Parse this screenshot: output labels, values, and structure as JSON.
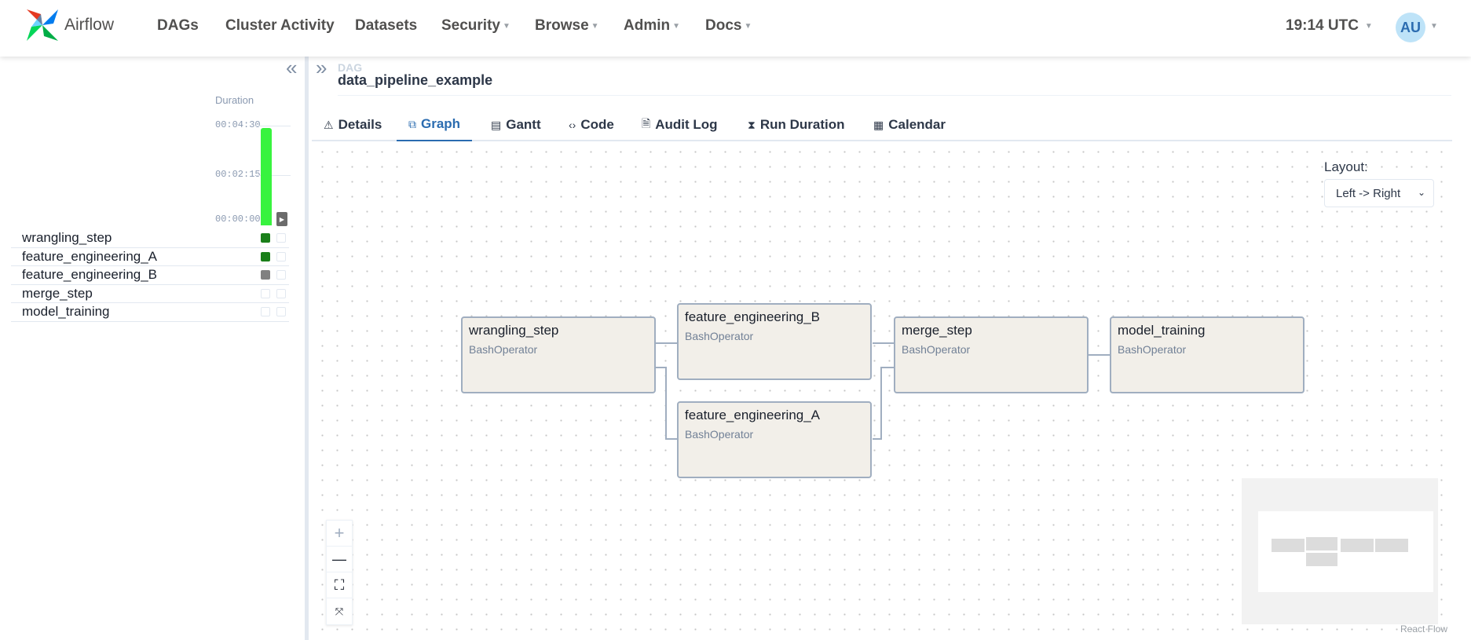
{
  "nav": {
    "brand": "Airflow",
    "items": [
      {
        "label": "DAGs",
        "caret": false
      },
      {
        "label": "Cluster Activity",
        "caret": false
      },
      {
        "label": "Datasets",
        "caret": false
      },
      {
        "label": "Security",
        "caret": true
      },
      {
        "label": "Browse",
        "caret": true
      },
      {
        "label": "Admin",
        "caret": true
      },
      {
        "label": "Docs",
        "caret": true
      }
    ],
    "clock": "19:14 UTC",
    "user_initials": "AU"
  },
  "left_panel": {
    "duration_label": "Duration",
    "ticks": [
      "00:04:30",
      "00:02:15",
      "00:00:00"
    ],
    "tasks": [
      {
        "name": "wrangling_step",
        "state": "success"
      },
      {
        "name": "feature_engineering_A",
        "state": "success"
      },
      {
        "name": "feature_engineering_B",
        "state": "grey"
      },
      {
        "name": "merge_step",
        "state": "none"
      },
      {
        "name": "model_training",
        "state": "none"
      }
    ]
  },
  "dag": {
    "label": "DAG",
    "title": "data_pipeline_example"
  },
  "tabs": [
    {
      "label": "Details",
      "icon": "warning-icon"
    },
    {
      "label": "Graph",
      "icon": "graph-icon",
      "active": true
    },
    {
      "label": "Gantt",
      "icon": "gantt-icon"
    },
    {
      "label": "Code",
      "icon": "code-icon"
    },
    {
      "label": "Audit Log",
      "icon": "audit-log-icon"
    },
    {
      "label": "Run Duration",
      "icon": "hourglass-icon"
    },
    {
      "label": "Calendar",
      "icon": "calendar-icon"
    }
  ],
  "graph": {
    "layout_label": "Layout:",
    "layout_value": "Left -> Right",
    "nodes": [
      {
        "name": "wrangling_step",
        "operator": "BashOperator"
      },
      {
        "name": "feature_engineering_B",
        "operator": "BashOperator"
      },
      {
        "name": "feature_engineering_A",
        "operator": "BashOperator"
      },
      {
        "name": "merge_step",
        "operator": "BashOperator"
      },
      {
        "name": "model_training",
        "operator": "BashOperator"
      }
    ],
    "attribution": "React Flow"
  },
  "colors": {
    "accent": "#2b6cb0",
    "success": "#1a7f1a",
    "duration_bar": "#38f33f",
    "node_fill": "#f2efe9"
  }
}
